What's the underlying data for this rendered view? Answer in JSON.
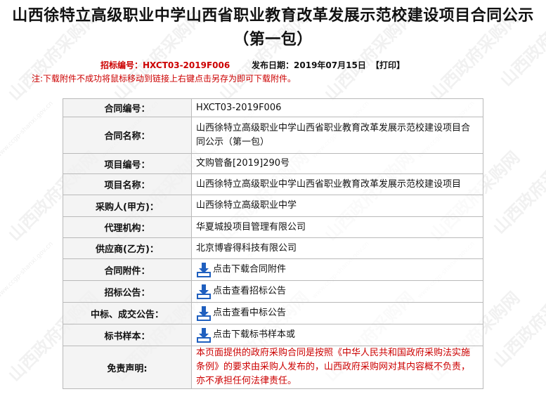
{
  "page": {
    "title": "山西徐特立高级职业中学山西省职业教育改革发展示范校建设项目合同公示（第一包）",
    "bid_label": "招标编号：",
    "bid_number": "HXCT03-2019F006",
    "publish_label": "发布日期：",
    "publish_date": "2019年07月15日",
    "print_label": "【打印】",
    "note": "注:下载附件不成功将鼠标移动到链接上右键点击另存为即可下载附件。"
  },
  "rows": [
    {
      "label": "合同编号：",
      "value": "HXCT03-2019F006"
    },
    {
      "label": "合同名称：",
      "value": "山西徐特立高级职业中学山西省职业教育改革发展示范校建设项目合同公示（第一包）"
    },
    {
      "label": "项目编号：",
      "value": "文购管备[2019]290号"
    },
    {
      "label": "项目名称：",
      "value": "山西徐特立高级职业中学山西省职业教育改革发展示范校建设项目"
    },
    {
      "label": "采购人(甲方)：",
      "value": "山西徐特立高级职业中学"
    },
    {
      "label": "代理机构：",
      "value": "华夏城投项目管理有限公司"
    },
    {
      "label": "供应商(乙方)：",
      "value": "北京博睿得科技有限公司"
    },
    {
      "label": "合同附件：",
      "link": "点击下载合同附件"
    },
    {
      "label": "招标公告：",
      "link": "点击查看招标公告"
    },
    {
      "label": "中标、成交公告：",
      "link": "点击查看中标公告"
    },
    {
      "label": "标书样本：",
      "link": "点击下载标书样本或"
    },
    {
      "label": "免责声明:",
      "value": "本页面提供的政府采购合同是按照《中华人民共和国政府采购法实施条例》的要求由采购人发布的，山西政府采购网对其内容概不负责，亦不承担任何法律责任。"
    }
  ],
  "watermark": {
    "text": "山西政府采购网",
    "url": "www.ccgp-shanxi.gov.cn"
  },
  "colors": {
    "accent_red": "#cc0000",
    "label_bg": "#f0f0f0",
    "border": "#b9b9b9",
    "icon_blue": "#1f5fbf"
  },
  "icons": {
    "download": "download-arrow-icon"
  }
}
